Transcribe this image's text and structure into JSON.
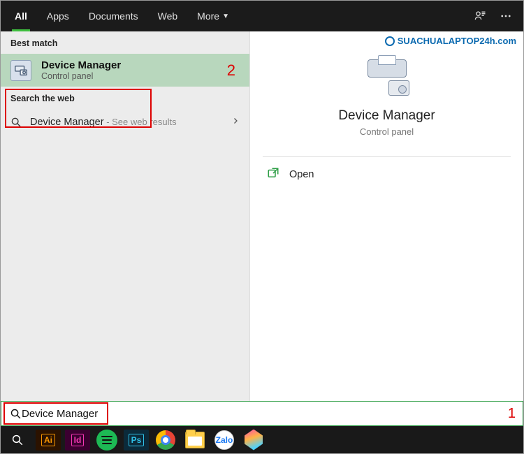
{
  "topbar": {
    "tabs": [
      "All",
      "Apps",
      "Documents",
      "Web",
      "More"
    ],
    "active_index": 0
  },
  "left": {
    "best_match_header": "Best match",
    "best_item": {
      "title": "Device Manager",
      "subtitle": "Control panel"
    },
    "search_web_header": "Search the web",
    "web_item": {
      "main": "Device Manager",
      "sub": " - See web results"
    }
  },
  "right": {
    "brand": "SUACHUALAPTOP24h.com",
    "title": "Device Manager",
    "subtitle": "Control panel",
    "actions": {
      "open": "Open"
    }
  },
  "search": {
    "value": "Device Manager"
  },
  "taskbar": {
    "ai": "Ai",
    "id": "Id",
    "ps": "Ps",
    "zalo": "Zalo"
  },
  "callouts": {
    "one": "1",
    "two": "2"
  }
}
